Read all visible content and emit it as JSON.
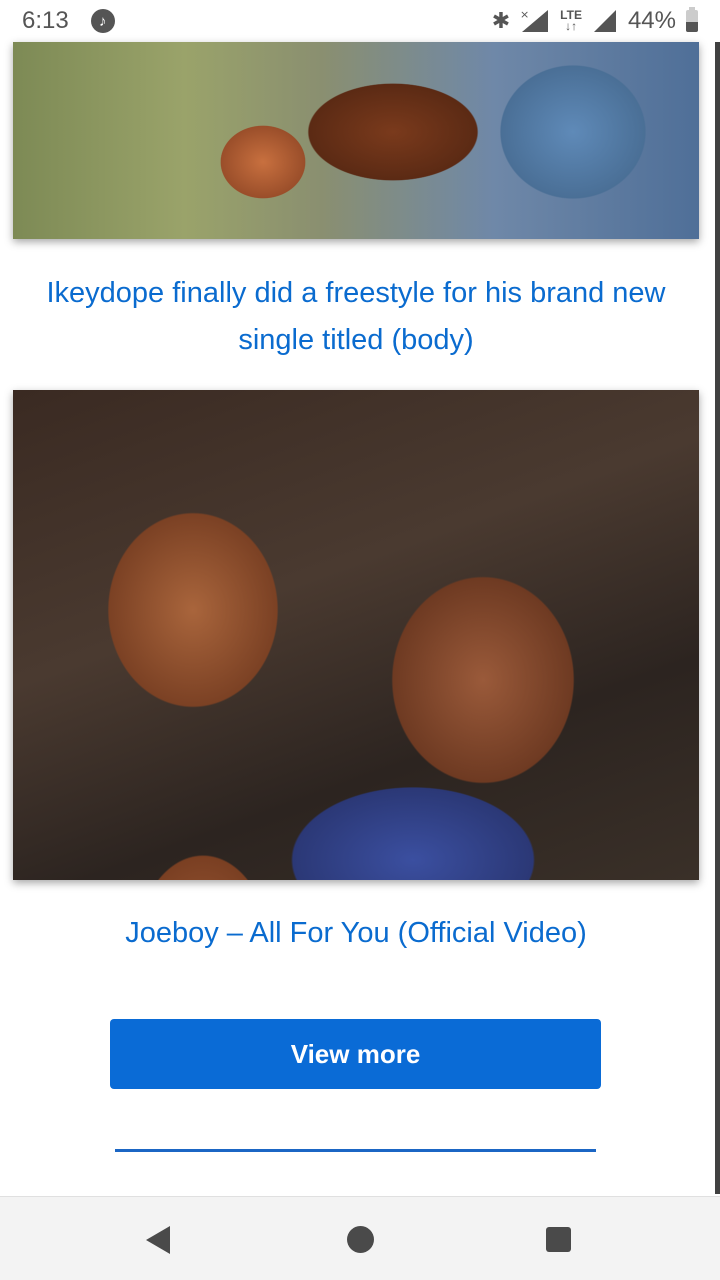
{
  "status_bar": {
    "time": "6:13",
    "network": "LTE",
    "battery": "44%",
    "icons": [
      "music-note-icon",
      "bluetooth-icon",
      "no-signal-icon",
      "lte-icon",
      "signal-icon",
      "battery-icon"
    ]
  },
  "articles": [
    {
      "title": "Ikeydope finally did a freestyle for his brand new single titled (body)"
    },
    {
      "title": "Joeboy – All For You (Official Video)"
    }
  ],
  "view_more_label": "View more",
  "nav": {
    "icons": [
      "back-icon",
      "home-icon",
      "recent-apps-icon"
    ]
  },
  "colors": {
    "link": "#0a6bcf",
    "button": "#0a6bd6"
  }
}
